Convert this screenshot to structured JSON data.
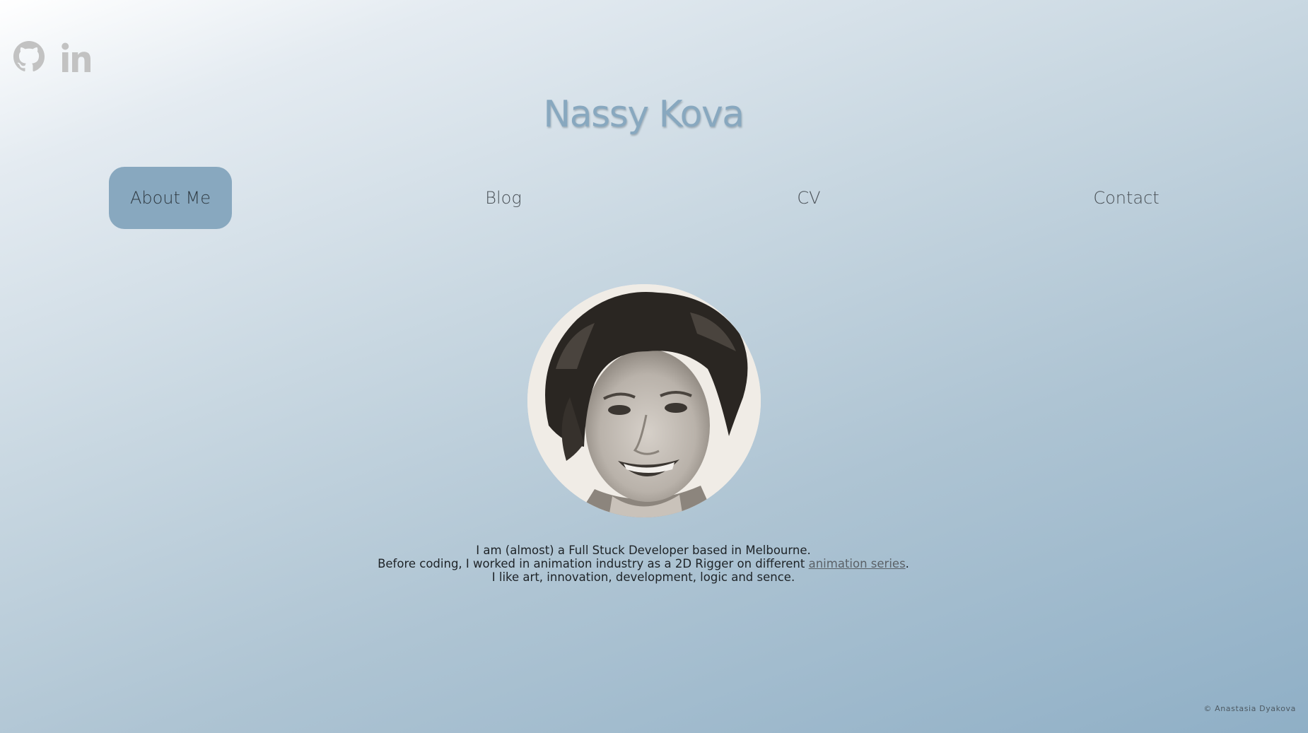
{
  "social": {
    "icons": [
      "github-icon",
      "linkedin-icon"
    ],
    "icon_color": "#c2c2c2"
  },
  "header": {
    "title": "Nassy Kova"
  },
  "nav": {
    "items": [
      {
        "label": "About Me",
        "active": true
      },
      {
        "label": "Blog",
        "active": false
      },
      {
        "label": "CV",
        "active": false
      },
      {
        "label": "Contact",
        "active": false
      }
    ],
    "active_color": "#88a8bf"
  },
  "profile": {
    "photo": "portrait-photo"
  },
  "bio": {
    "line1": "I am (almost) a Full Stuck Developer based in Melbourne.",
    "line2_before": "Before coding, I worked in animation industry as a 2D Rigger on different ",
    "line2_link": "animation series",
    "line2_after": ".",
    "line3": "I like art, innovation, development, logic and sence."
  },
  "footer": {
    "copyright": "© Anastasia Dyakova"
  },
  "colors": {
    "accent": "#88a8bf",
    "text": "#2a2f33"
  }
}
